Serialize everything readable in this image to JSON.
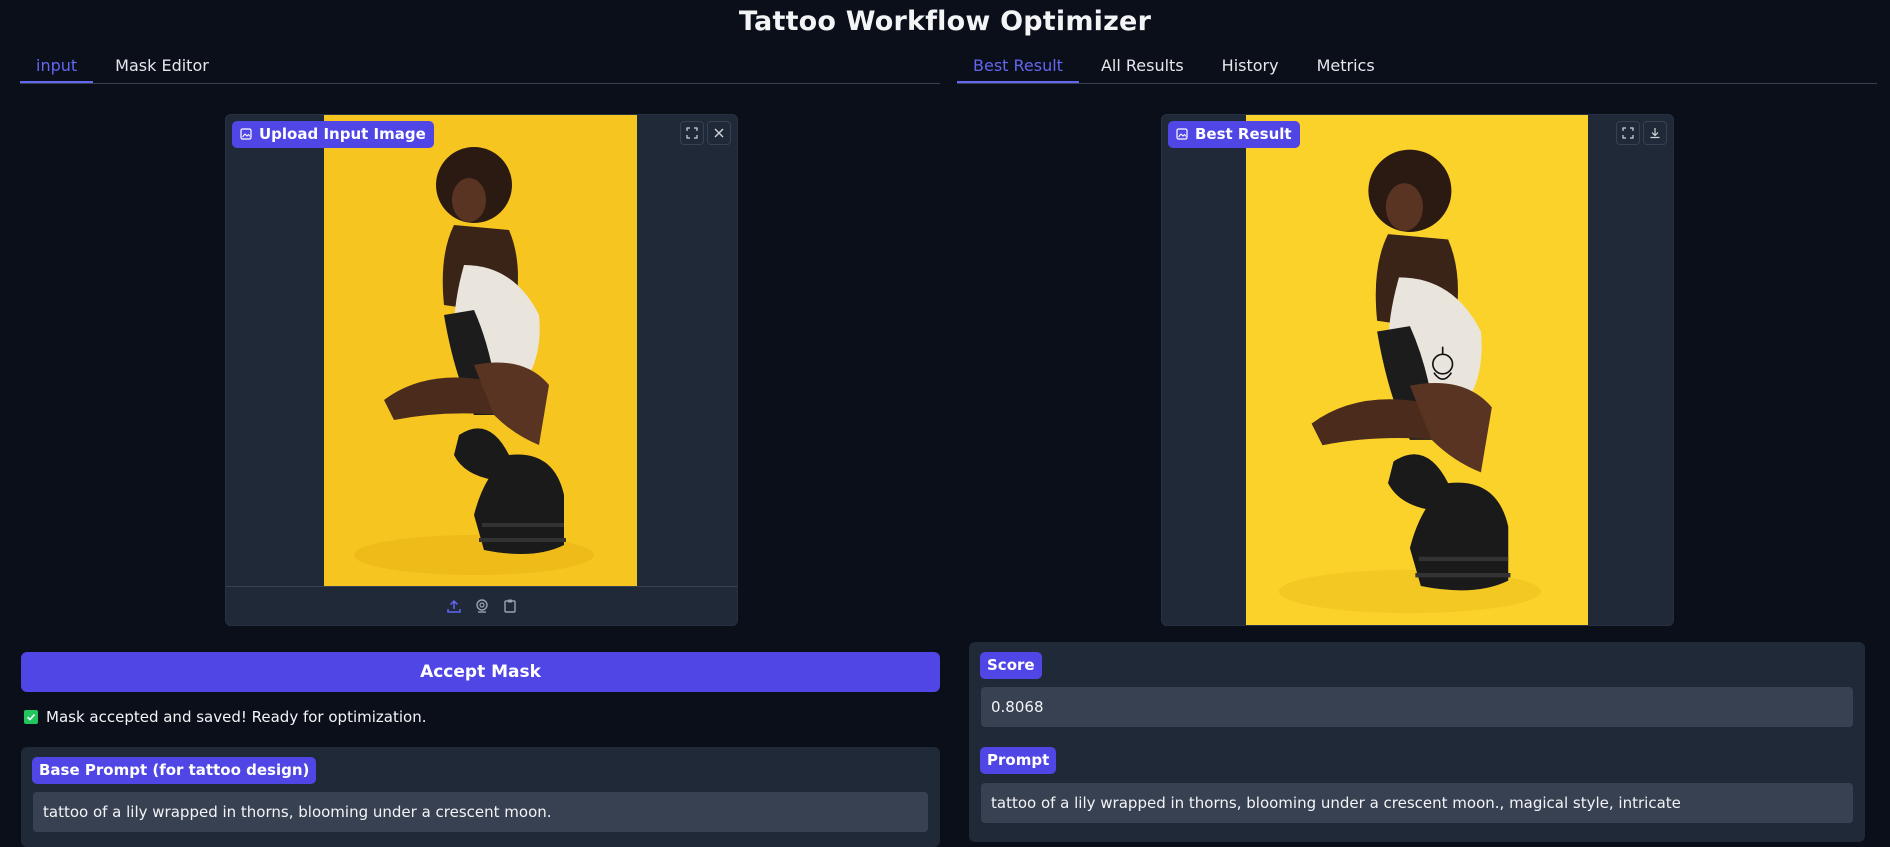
{
  "app": {
    "title": "Tattoo Workflow Optimizer"
  },
  "left_tabs": [
    {
      "label": "input",
      "active": true
    },
    {
      "label": "Mask Editor",
      "active": false
    }
  ],
  "right_tabs": [
    {
      "label": "Best Result",
      "active": true
    },
    {
      "label": "All Results",
      "active": false
    },
    {
      "label": "History",
      "active": false
    },
    {
      "label": "Metrics",
      "active": false
    }
  ],
  "input_panel": {
    "label": "Upload Input Image",
    "icons": [
      "fullscreen-icon",
      "close-icon"
    ],
    "footer_icons": [
      "upload-icon",
      "webcam-icon",
      "clipboard-icon"
    ]
  },
  "result_panel": {
    "label": "Best Result",
    "icons": [
      "fullscreen-icon",
      "download-icon"
    ]
  },
  "accept_button": {
    "label": "Accept Mask"
  },
  "status": {
    "text": "Mask accepted and saved! Ready for optimization."
  },
  "base_prompt": {
    "label": "Base Prompt (for tattoo design)",
    "value": "tattoo of a lily wrapped in thorns, blooming under a crescent moon."
  },
  "score": {
    "label": "Score",
    "value": "0.8068"
  },
  "prompt": {
    "label": "Prompt",
    "value": "tattoo of a lily wrapped in thorns, blooming under a crescent moon., magical style, intricate"
  },
  "colors": {
    "accent": "#4f46e5",
    "background": "#0b0f19",
    "panel": "#1f2937",
    "field": "#374151",
    "photo_bg": "#f7c51f"
  }
}
